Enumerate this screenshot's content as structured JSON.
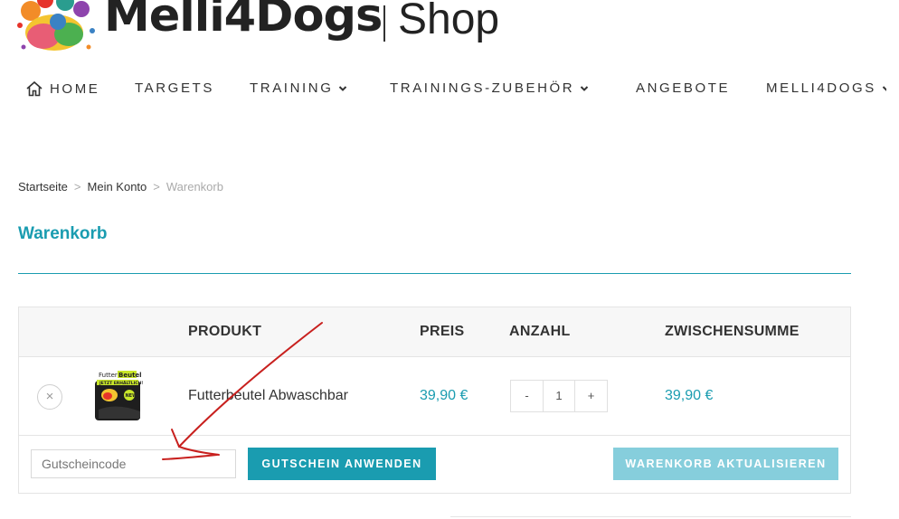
{
  "header": {
    "brand": "Melli4Dogs",
    "shop_label": "Shop"
  },
  "nav": {
    "items": [
      {
        "label": "HOME",
        "icon": "home-icon",
        "dropdown": false
      },
      {
        "label": "TARGETS",
        "dropdown": false
      },
      {
        "label": "TRAINING",
        "dropdown": true
      },
      {
        "label": "TRAININGS-ZUBEHÖR",
        "dropdown": true
      },
      {
        "label": "ANGEBOTE",
        "dropdown": false
      },
      {
        "label": "MELLI4DOGS",
        "dropdown": true
      }
    ]
  },
  "breadcrumb": {
    "items": [
      "Startseite",
      "Mein Konto",
      "Warenkorb"
    ],
    "separator": ">"
  },
  "page": {
    "title": "Warenkorb"
  },
  "cart": {
    "columns": [
      "PRODUKT",
      "PREIS",
      "ANZAHL",
      "ZWISCHENSUMME"
    ],
    "rows": [
      {
        "product": "Futterbeutel Abwaschbar",
        "price": "39,90 €",
        "quantity": "1",
        "subtotal": "39,90 €",
        "thumb_text": [
          "Futter",
          "Beutel",
          "JETZT ERHÄLTLICH!",
          "NEW"
        ]
      }
    ],
    "remove_symbol": "×",
    "qty_minus": "-",
    "qty_plus": "+",
    "coupon_placeholder": "Gutscheincode",
    "coupon_button": "GUTSCHEIN ANWENDEN",
    "update_button": "WARENKORB AKTUALISIEREN"
  },
  "colors": {
    "accent": "#1a9cb0",
    "accent_light": "#86cedc",
    "annotation_arrow": "#c8201e"
  }
}
